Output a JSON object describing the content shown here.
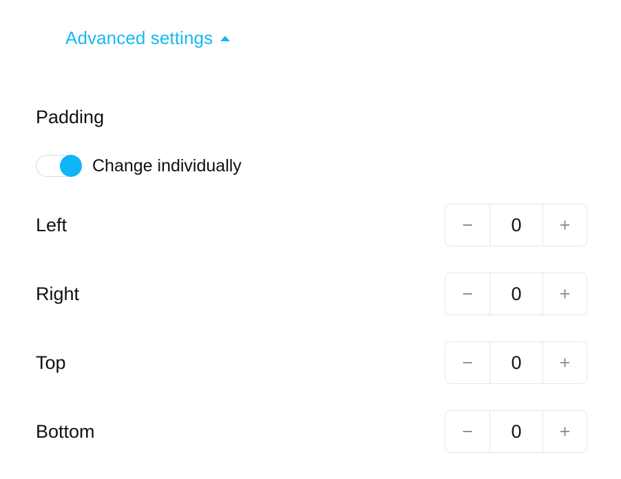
{
  "advanced_settings": {
    "label": "Advanced settings",
    "expand_icon": "caret-up-icon",
    "expanded": true,
    "accent_color": "#17b8f4"
  },
  "padding_section": {
    "title": "Padding",
    "toggle": {
      "label": "Change individually",
      "state": "on",
      "on_color": "#0fb5f5",
      "track_border_color": "#d9dde1"
    },
    "stepper_icons": {
      "decrement": "minus-icon",
      "increment": "plus-icon"
    },
    "rows": [
      {
        "label": "Left",
        "value": "0",
        "decrement": "−",
        "increment": "+"
      },
      {
        "label": "Right",
        "value": "0",
        "decrement": "−",
        "increment": "+"
      },
      {
        "label": "Top",
        "value": "0",
        "decrement": "−",
        "increment": "+"
      },
      {
        "label": "Bottom",
        "value": "0",
        "decrement": "−",
        "increment": "+"
      }
    ]
  },
  "theme": {
    "background": "#ffffff",
    "text_color": "#111111",
    "stepper_border": "#e2e5e8",
    "stepper_sign_color": "#7d91a1"
  }
}
